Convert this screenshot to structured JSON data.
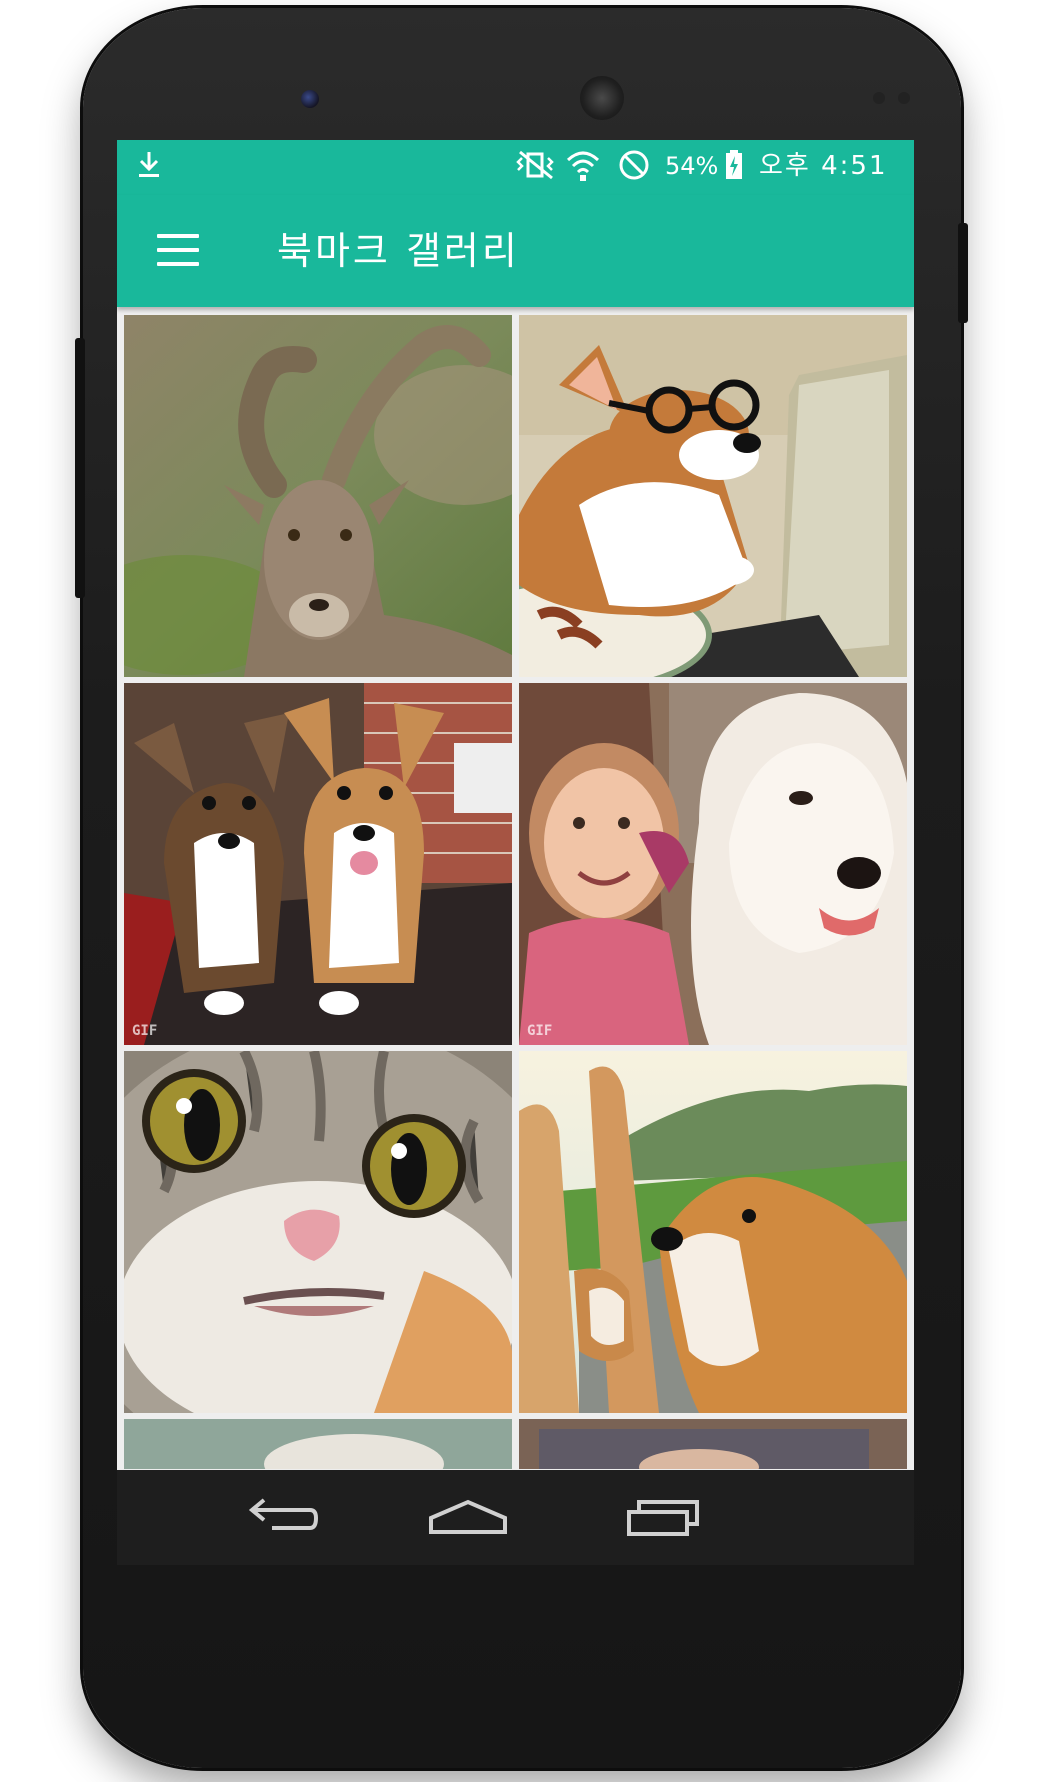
{
  "status_bar": {
    "battery": "54%",
    "time": "오후 4:51",
    "icons": [
      "download-icon",
      "vibrate-icon",
      "wifi-icon",
      "do-not-disturb-icon",
      "battery-charging-icon"
    ]
  },
  "app_bar": {
    "title": "북마크 갤러리",
    "menu_icon": "hamburger-menu-icon"
  },
  "gallery": {
    "items": [
      {
        "subject": "ibex",
        "gif": false
      },
      {
        "subject": "corgi with glasses",
        "gif": false
      },
      {
        "subject": "two corgi puppies",
        "gif": true,
        "badge": "GIF"
      },
      {
        "subject": "child and samoyed",
        "gif": true,
        "badge": "GIF"
      },
      {
        "subject": "kitten",
        "gif": false
      },
      {
        "subject": "shiba inu",
        "gif": false
      }
    ]
  },
  "nav_bar": {
    "buttons": [
      "back-icon",
      "home-icon",
      "recents-icon"
    ]
  },
  "colors": {
    "primary": "#19b89b",
    "background": "#eeeeee",
    "nav_bar": "#1e1e1e"
  }
}
